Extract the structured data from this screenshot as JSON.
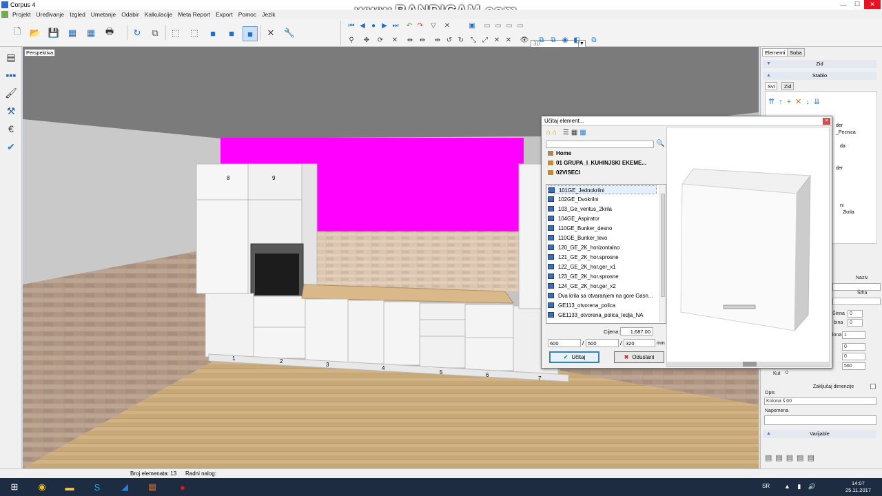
{
  "app": {
    "title": "Corpus 4",
    "watermark": "www.BANDICAM.com"
  },
  "menu": [
    "Projekt",
    "Uređivanje",
    "Izgled",
    "Umetanje",
    "Odabir",
    "Kalkulacije",
    "Meta Report",
    "Export",
    "Pomoc",
    "Jezik"
  ],
  "toolbar": {
    "view_select": "3D"
  },
  "viewport": {
    "label": "Perspektiva",
    "wall_color": "#ff00ff",
    "element_numbers": [
      "8",
      "9",
      "1",
      "2",
      "3",
      "4",
      "5",
      "6",
      "7"
    ]
  },
  "right_panel": {
    "tabs": [
      "Elementi",
      "Soba"
    ],
    "zid_section": "Zid",
    "stablo_section": "Stablo",
    "inner_tabs": [
      "Svi",
      "Zid"
    ],
    "partial_texts": [
      "der",
      "_Pecnica",
      "da",
      "der",
      "ni",
      "2krila"
    ],
    "naziv_label": "Naziv",
    "sifra_label": "Šifra",
    "sirina_label": "Širina",
    "dubina_label": "bina",
    "sirina_value": "0",
    "dubina_value": "0",
    "kolona_label": "lona",
    "kolona_value": "1",
    "x_value": "0",
    "y_value": "0",
    "z_value": "560",
    "kut_label": "Kut",
    "kut_value": "0",
    "zakljucaj_label": "Zaključaj dimenzije",
    "opis_label": "Opis",
    "opis_value": "Kolona š 60",
    "napomena_label": "Napomena",
    "varijable_section": "Varijable"
  },
  "status": {
    "broj": "Broj elemenata: 13",
    "radni": "Radni nalog:"
  },
  "taskbar": {
    "lang": "SR",
    "time": "14:07",
    "date": "25.11.2017"
  },
  "dialog": {
    "title": "Učitaj element...",
    "tree": [
      "Home",
      "01 GRUPA_I_KUHINJSKI EKEME...",
      "02VISECI"
    ],
    "items": [
      "101GE_Jednokrilni",
      "102GE_Dvokrilni",
      "103_Ge_ventus_2krila",
      "104GE_Aspirator",
      "110GE_Bunker_desno",
      "110GE_Bunker_levo",
      "120_GE_2K_horizontalno",
      "121_GE_2K_hor.sprosne",
      "122_GE_2K_hor.ger_x1",
      "123_GE_2K_hor.sprosne",
      "124_GE_2K_hor.ger_x2",
      "Dva krila sa otvaranjem na gore Gasn...",
      "GE113_otvorena_polica",
      "GE1133_otvorena_polica_ledja_NA"
    ],
    "selected_index": 0,
    "price_label": "Cijena:",
    "price_value": "1,687.00",
    "dim1": "600",
    "dim2": "500",
    "dim3": "320",
    "unit": "mm",
    "ok_label": "Učitaj",
    "cancel_label": "Odustani"
  }
}
